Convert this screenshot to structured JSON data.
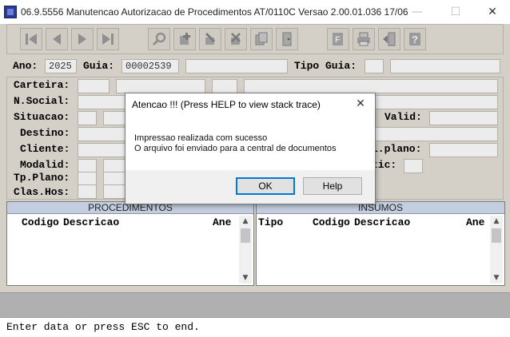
{
  "window": {
    "title": "06.9.5556 Manutencao Autorizacao de Procedimentos AT/0110C Versao 2.00.01.036 17/06...",
    "min_glyph": "—",
    "max_glyph": "☐",
    "close_glyph": "✕"
  },
  "toolbar": {
    "buttons": [
      {
        "name": "first-record",
        "icon": "first-icon"
      },
      {
        "name": "previous-record",
        "icon": "previous-icon"
      },
      {
        "name": "next-record",
        "icon": "next-icon"
      },
      {
        "name": "last-record",
        "icon": "last-icon"
      },
      {
        "name": "search",
        "icon": "zoom-icon"
      },
      {
        "name": "add",
        "icon": "add-icon"
      },
      {
        "name": "edit",
        "icon": "edit-icon"
      },
      {
        "name": "delete",
        "icon": "delete-icon"
      },
      {
        "name": "copy",
        "icon": "copy-icon"
      },
      {
        "name": "open",
        "icon": "door-icon"
      },
      {
        "name": "filter",
        "icon": "filter-icon"
      },
      {
        "name": "print",
        "icon": "printer-icon"
      },
      {
        "name": "exit",
        "icon": "exit-icon"
      },
      {
        "name": "help",
        "icon": "help-icon"
      }
    ]
  },
  "header": {
    "ano_label": "Ano:",
    "ano_value": "2025",
    "guia_label": "Guia:",
    "guia_value": "00002539",
    "tipo_guia_label": "Tipo Guia:"
  },
  "form": {
    "carteira": "Carteira:",
    "nsocial": "N.Social:",
    "situacao": "Situacao:",
    "destino": "Destino:",
    "cliente": "Cliente:",
    "modalid": "Modalid:",
    "tpplano": "Tp.Plano:",
    "claseshos": "Clas.Hos:",
    "valid": "Valid:",
    "lplano": "l.plano:",
    "tic": "tic:"
  },
  "procedimentos": {
    "title": "PROCEDIMENTOS",
    "columns": [
      "Codigo",
      "Descricao",
      "Ane"
    ]
  },
  "insumos": {
    "title": "INSUMOS",
    "columns": [
      "Tipo",
      "Codigo",
      "Descricao",
      "Ane"
    ]
  },
  "scroll": {
    "up": "▲",
    "down": "▼"
  },
  "dialog": {
    "title": "Atencao !!!  (Press HELP to view stack trace)",
    "close": "✕",
    "line1": "Impressao realizada com sucesso",
    "line2": "O arquivo foi enviado para a central de documentos",
    "ok_label": "OK",
    "help_label": "Help"
  },
  "status": {
    "text": "Enter data or press ESC to end."
  },
  "colors": {
    "background": "#d4d0c8",
    "grid_header": "#c3cfe0",
    "focus": "#0078d7"
  }
}
